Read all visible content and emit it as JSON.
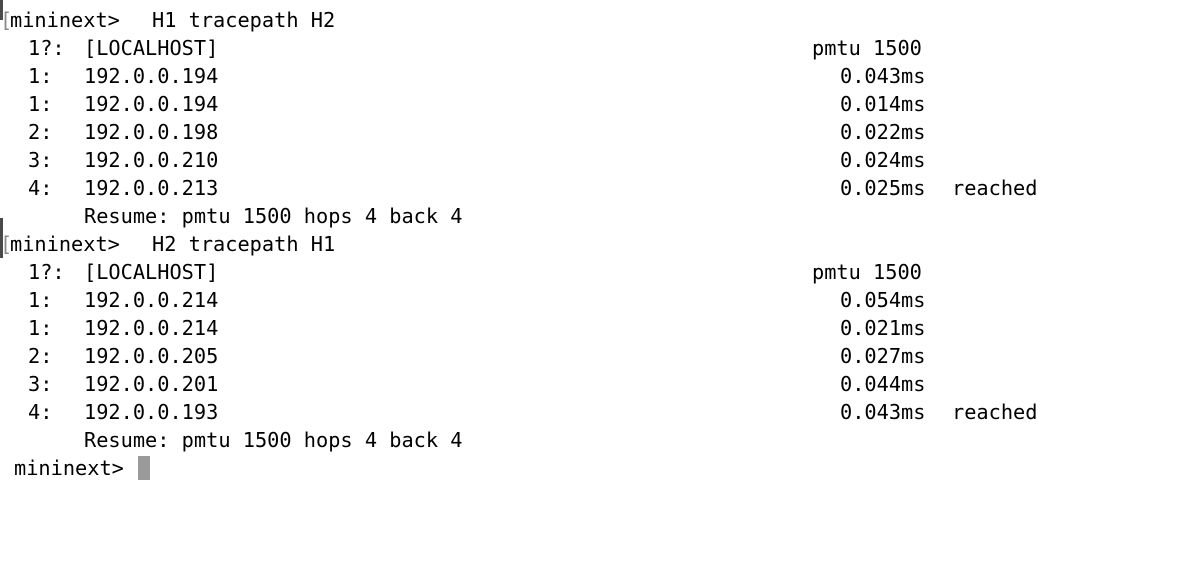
{
  "session1": {
    "prompt": "mininext>",
    "command": "H1 tracepath H2",
    "localhost": {
      "index": "1?:",
      "label": "[LOCALHOST]",
      "pmtu": "pmtu 1500"
    },
    "hops": [
      {
        "index": "1:",
        "ip": "192.0.0.194",
        "time": "0.043ms",
        "status": ""
      },
      {
        "index": "1:",
        "ip": "192.0.0.194",
        "time": "0.014ms",
        "status": ""
      },
      {
        "index": "2:",
        "ip": "192.0.0.198",
        "time": "0.022ms",
        "status": ""
      },
      {
        "index": "3:",
        "ip": "192.0.0.210",
        "time": "0.024ms",
        "status": ""
      },
      {
        "index": "4:",
        "ip": "192.0.0.213",
        "time": "0.025ms",
        "status": "reached"
      }
    ],
    "resume": "Resume: pmtu 1500 hops 4 back 4"
  },
  "session2": {
    "prompt": "mininext>",
    "command": "H2 tracepath H1",
    "localhost": {
      "index": "1?:",
      "label": "[LOCALHOST]",
      "pmtu": "pmtu 1500"
    },
    "hops": [
      {
        "index": "1:",
        "ip": "192.0.0.214",
        "time": "0.054ms",
        "status": ""
      },
      {
        "index": "1:",
        "ip": "192.0.0.214",
        "time": "0.021ms",
        "status": ""
      },
      {
        "index": "2:",
        "ip": "192.0.0.205",
        "time": "0.027ms",
        "status": ""
      },
      {
        "index": "3:",
        "ip": "192.0.0.201",
        "time": "0.044ms",
        "status": ""
      },
      {
        "index": "4:",
        "ip": "192.0.0.193",
        "time": "0.043ms",
        "status": "reached"
      }
    ],
    "resume": "Resume: pmtu 1500 hops 4 back 4"
  },
  "current_prompt": "mininext>",
  "colors": {
    "background": "#ffffff",
    "text": "#000000",
    "cursor": "#9a9a9a"
  }
}
